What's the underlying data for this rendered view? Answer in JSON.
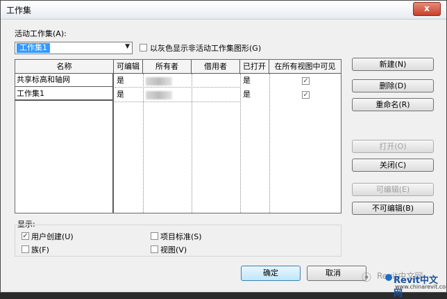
{
  "window": {
    "title": "工作集",
    "close_glyph": "x"
  },
  "active_workset": {
    "label": "活动工作集(A):",
    "selected": "工作集1",
    "gray_checkbox_label": "以灰色显示非活动工作集图形(G)",
    "gray_checked": false
  },
  "table": {
    "columns": [
      "名称",
      "可编辑",
      "所有者",
      "借用者",
      "已打开",
      "在所有视图中可见"
    ],
    "rows": [
      {
        "name": "共享标高和轴网",
        "editable": "是",
        "opened": "是",
        "visible": true
      },
      {
        "name": "工作集1",
        "editable": "是",
        "opened": "是",
        "visible": true
      }
    ]
  },
  "buttons": {
    "new": "新建(N)",
    "delete": "删除(D)",
    "rename": "重命名(R)",
    "open": "打开(O)",
    "close": "关闭(C)",
    "editable": "可编辑(E)",
    "non_editable": "不可编辑(B)",
    "ok": "确定",
    "cancel": "取消"
  },
  "show": {
    "label": "显示:",
    "user_created": "用户创建(U)",
    "user_created_checked": true,
    "families": "族(F)",
    "families_checked": false,
    "project_standards": "项目标准(S)",
    "project_standards_checked": false,
    "views": "视图(V)",
    "views_checked": false
  },
  "watermark": {
    "logo": "Revit中文网",
    "url": "www.chinarevit.com",
    "wechat_text": "Revit中文网"
  },
  "icons": {
    "check": "✓",
    "dropdown": "▼"
  },
  "colors": {
    "selection": "#3399ff",
    "dialog_bg": "#f0f0f0",
    "close_red": "#c8402a"
  }
}
